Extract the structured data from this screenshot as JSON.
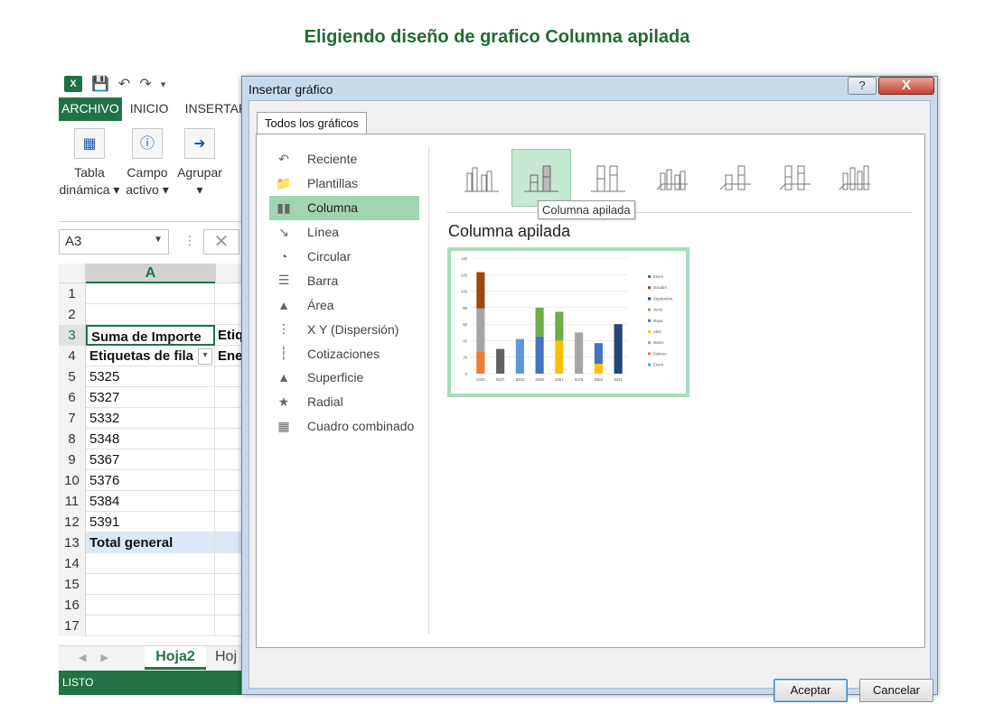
{
  "page_heading": "Eligiendo diseño de grafico Columna apilada",
  "excel": {
    "ribbon_tabs": [
      "ARCHIVO",
      "INICIO",
      "INSERTAR"
    ],
    "ribbon_buttons": [
      {
        "line1": "Tabla",
        "line2": "dinámica ▾"
      },
      {
        "line1": "Campo",
        "line2": "activo ▾"
      },
      {
        "line1": "Agrupar",
        "line2": "▾"
      }
    ],
    "name_box": "A3",
    "column_header": "A",
    "rows": [
      {
        "n": "1",
        "a": "",
        "b": ""
      },
      {
        "n": "2",
        "a": "",
        "b": ""
      },
      {
        "n": "3",
        "a": "Suma de Importe",
        "b": "Etiq"
      },
      {
        "n": "4",
        "a": "Etiquetas de fila",
        "b": "Ene"
      },
      {
        "n": "5",
        "a": "5325",
        "b": ""
      },
      {
        "n": "6",
        "a": "5327",
        "b": ""
      },
      {
        "n": "7",
        "a": "5332",
        "b": ""
      },
      {
        "n": "8",
        "a": "5348",
        "b": ""
      },
      {
        "n": "9",
        "a": "5367",
        "b": ""
      },
      {
        "n": "10",
        "a": "5376",
        "b": ""
      },
      {
        "n": "11",
        "a": "5384",
        "b": ""
      },
      {
        "n": "12",
        "a": "5391",
        "b": ""
      },
      {
        "n": "13",
        "a": "Total general",
        "b": ""
      },
      {
        "n": "14",
        "a": "",
        "b": ""
      },
      {
        "n": "15",
        "a": "",
        "b": ""
      },
      {
        "n": "16",
        "a": "",
        "b": ""
      },
      {
        "n": "17",
        "a": "",
        "b": ""
      }
    ],
    "sheet_tabs": [
      "Hoja2",
      "Hoj"
    ],
    "status": "LISTO"
  },
  "dialog": {
    "title": "Insertar gráfico",
    "help": "?",
    "close": "X",
    "tab": "Todos los gráficos",
    "chart_types": [
      "Reciente",
      "Plantillas",
      "Columna",
      "Línea",
      "Circular",
      "Barra",
      "Área",
      "X Y (Dispersión)",
      "Cotizaciones",
      "Superficie",
      "Radial",
      "Cuadro combinado"
    ],
    "chart_type_icons": [
      "undo-arrow-icon",
      "folder-icon",
      "column-chart-icon",
      "line-chart-icon",
      "pie-chart-icon",
      "bar-chart-icon",
      "area-chart-icon",
      "scatter-chart-icon",
      "stock-chart-icon",
      "surface-chart-icon",
      "radar-chart-icon",
      "combo-chart-icon"
    ],
    "selected_type": "Columna",
    "subtype_tooltip": "Columna apilada",
    "preview_title": "Columna apilada",
    "ok": "Aceptar",
    "cancel": "Cancelar"
  },
  "chart_data": {
    "type": "bar",
    "stacked": true,
    "categories": [
      "5325",
      "5327",
      "5332",
      "5348",
      "5367",
      "5376",
      "5384",
      "5391"
    ],
    "ylim": [
      0,
      140
    ],
    "yticks": [
      "0",
      "20",
      "40",
      "60",
      "80",
      "100",
      "120",
      "140"
    ],
    "series": [
      {
        "name": "Enero",
        "color": "#5b9bd5",
        "values": [
          0,
          0,
          42,
          0,
          0,
          0,
          0,
          0
        ]
      },
      {
        "name": "Febrero",
        "color": "#ed7d31",
        "values": [
          27,
          0,
          0,
          0,
          0,
          0,
          0,
          0
        ]
      },
      {
        "name": "Marzo",
        "color": "#a5a5a5",
        "values": [
          52,
          0,
          0,
          0,
          0,
          50,
          0,
          0
        ]
      },
      {
        "name": "Abril",
        "color": "#ffc000",
        "values": [
          0,
          0,
          0,
          0,
          40,
          0,
          12,
          0
        ]
      },
      {
        "name": "Mayo",
        "color": "#4472c4",
        "values": [
          0,
          0,
          0,
          45,
          0,
          0,
          25,
          0
        ]
      },
      {
        "name": "Junio",
        "color": "#70ad47",
        "values": [
          0,
          0,
          0,
          35,
          35,
          0,
          0,
          0
        ]
      },
      {
        "name": "Septiembre",
        "color": "#264478",
        "values": [
          0,
          0,
          0,
          0,
          0,
          0,
          0,
          60
        ]
      },
      {
        "name": "Octubre",
        "color": "#9e480e",
        "values": [
          44,
          0,
          0,
          0,
          0,
          0,
          0,
          0
        ]
      },
      {
        "name": "Enero",
        "color": "#636363",
        "values": [
          0,
          30,
          0,
          0,
          0,
          0,
          0,
          0
        ]
      }
    ],
    "legend_position": "right"
  }
}
